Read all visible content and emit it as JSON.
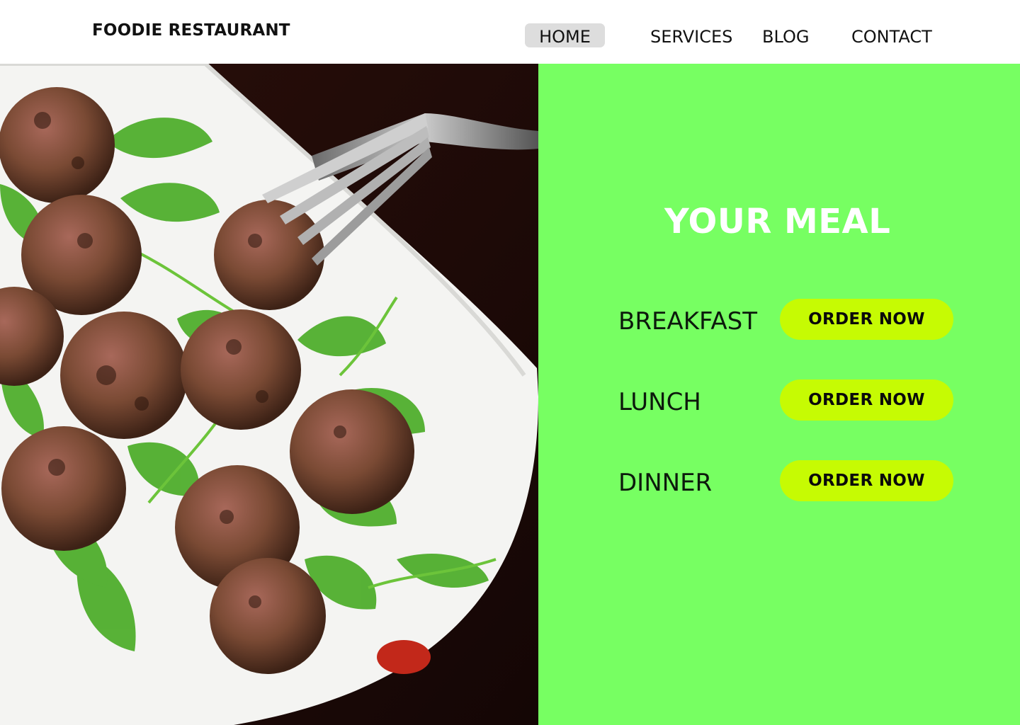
{
  "header": {
    "brand": "FOODIE RESTAURANT",
    "nav": {
      "home": "HOME",
      "services": "SERVICES",
      "blog": "BLOG",
      "contact": "CONTACT"
    }
  },
  "hero": {
    "title": "YOUR MEAL",
    "meals": [
      {
        "label": "BREAKFAST",
        "button": "ORDER NOW"
      },
      {
        "label": "LUNCH",
        "button": "ORDER NOW"
      },
      {
        "label": "DINNER",
        "button": "ORDER NOW"
      }
    ]
  },
  "colors": {
    "panel_green": "#77ff62",
    "button_lime": "#c6fb03",
    "nav_active_bg": "#dddddd"
  }
}
